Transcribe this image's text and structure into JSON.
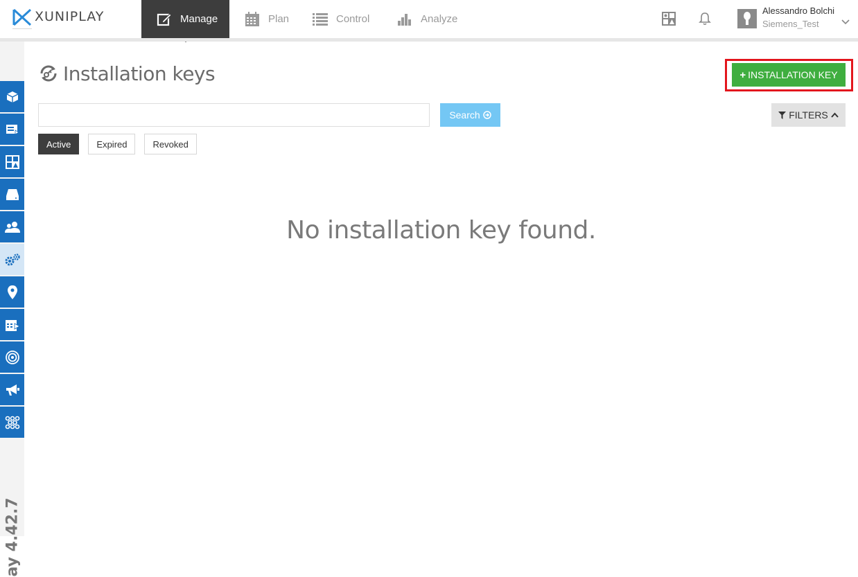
{
  "app": {
    "logo_text": "XUNIPLAY",
    "version": "ay 4.42.7"
  },
  "nav": [
    {
      "label": "Manage",
      "icon": "edit-icon",
      "active": true
    },
    {
      "label": "Plan",
      "icon": "calendar-icon",
      "active": false
    },
    {
      "label": "Control",
      "icon": "list-icon",
      "active": false
    },
    {
      "label": "Analyze",
      "icon": "bar-chart-icon",
      "active": false
    }
  ],
  "header_right": {
    "widgets_icon": "dashboard-icon",
    "notifications_icon": "bell-icon",
    "user_name": "Alessandro Bolchi",
    "user_org": "Siemens_Test"
  },
  "sidebar": {
    "items": [
      {
        "icon": "package-icon"
      },
      {
        "icon": "player-icon"
      },
      {
        "icon": "layout-icon"
      },
      {
        "icon": "storage-icon"
      },
      {
        "icon": "users-icon"
      },
      {
        "icon": "settings-gears-icon",
        "active": true
      },
      {
        "icon": "location-pin-icon"
      },
      {
        "icon": "schedule-icon"
      },
      {
        "icon": "broadcast-icon"
      },
      {
        "icon": "megaphone-icon"
      },
      {
        "icon": "network-icon"
      }
    ]
  },
  "page": {
    "title": "Installation keys",
    "add_button_label": "INSTALLATION KEY",
    "add_button_plus": "+",
    "search_value": "",
    "search_button_label": "Search",
    "filters_label": "FILTERS",
    "tabs": [
      {
        "label": "Active",
        "active": true
      },
      {
        "label": "Expired",
        "active": false
      },
      {
        "label": "Revoked",
        "active": false
      }
    ],
    "empty_message": "No installation key found."
  },
  "colors": {
    "sidebar_blue": "#1a6fbe",
    "green_button": "#3fae3f",
    "highlight_red": "#e3161d",
    "search_blue": "#74c7f4",
    "dark_nav": "#3d3d3d"
  }
}
